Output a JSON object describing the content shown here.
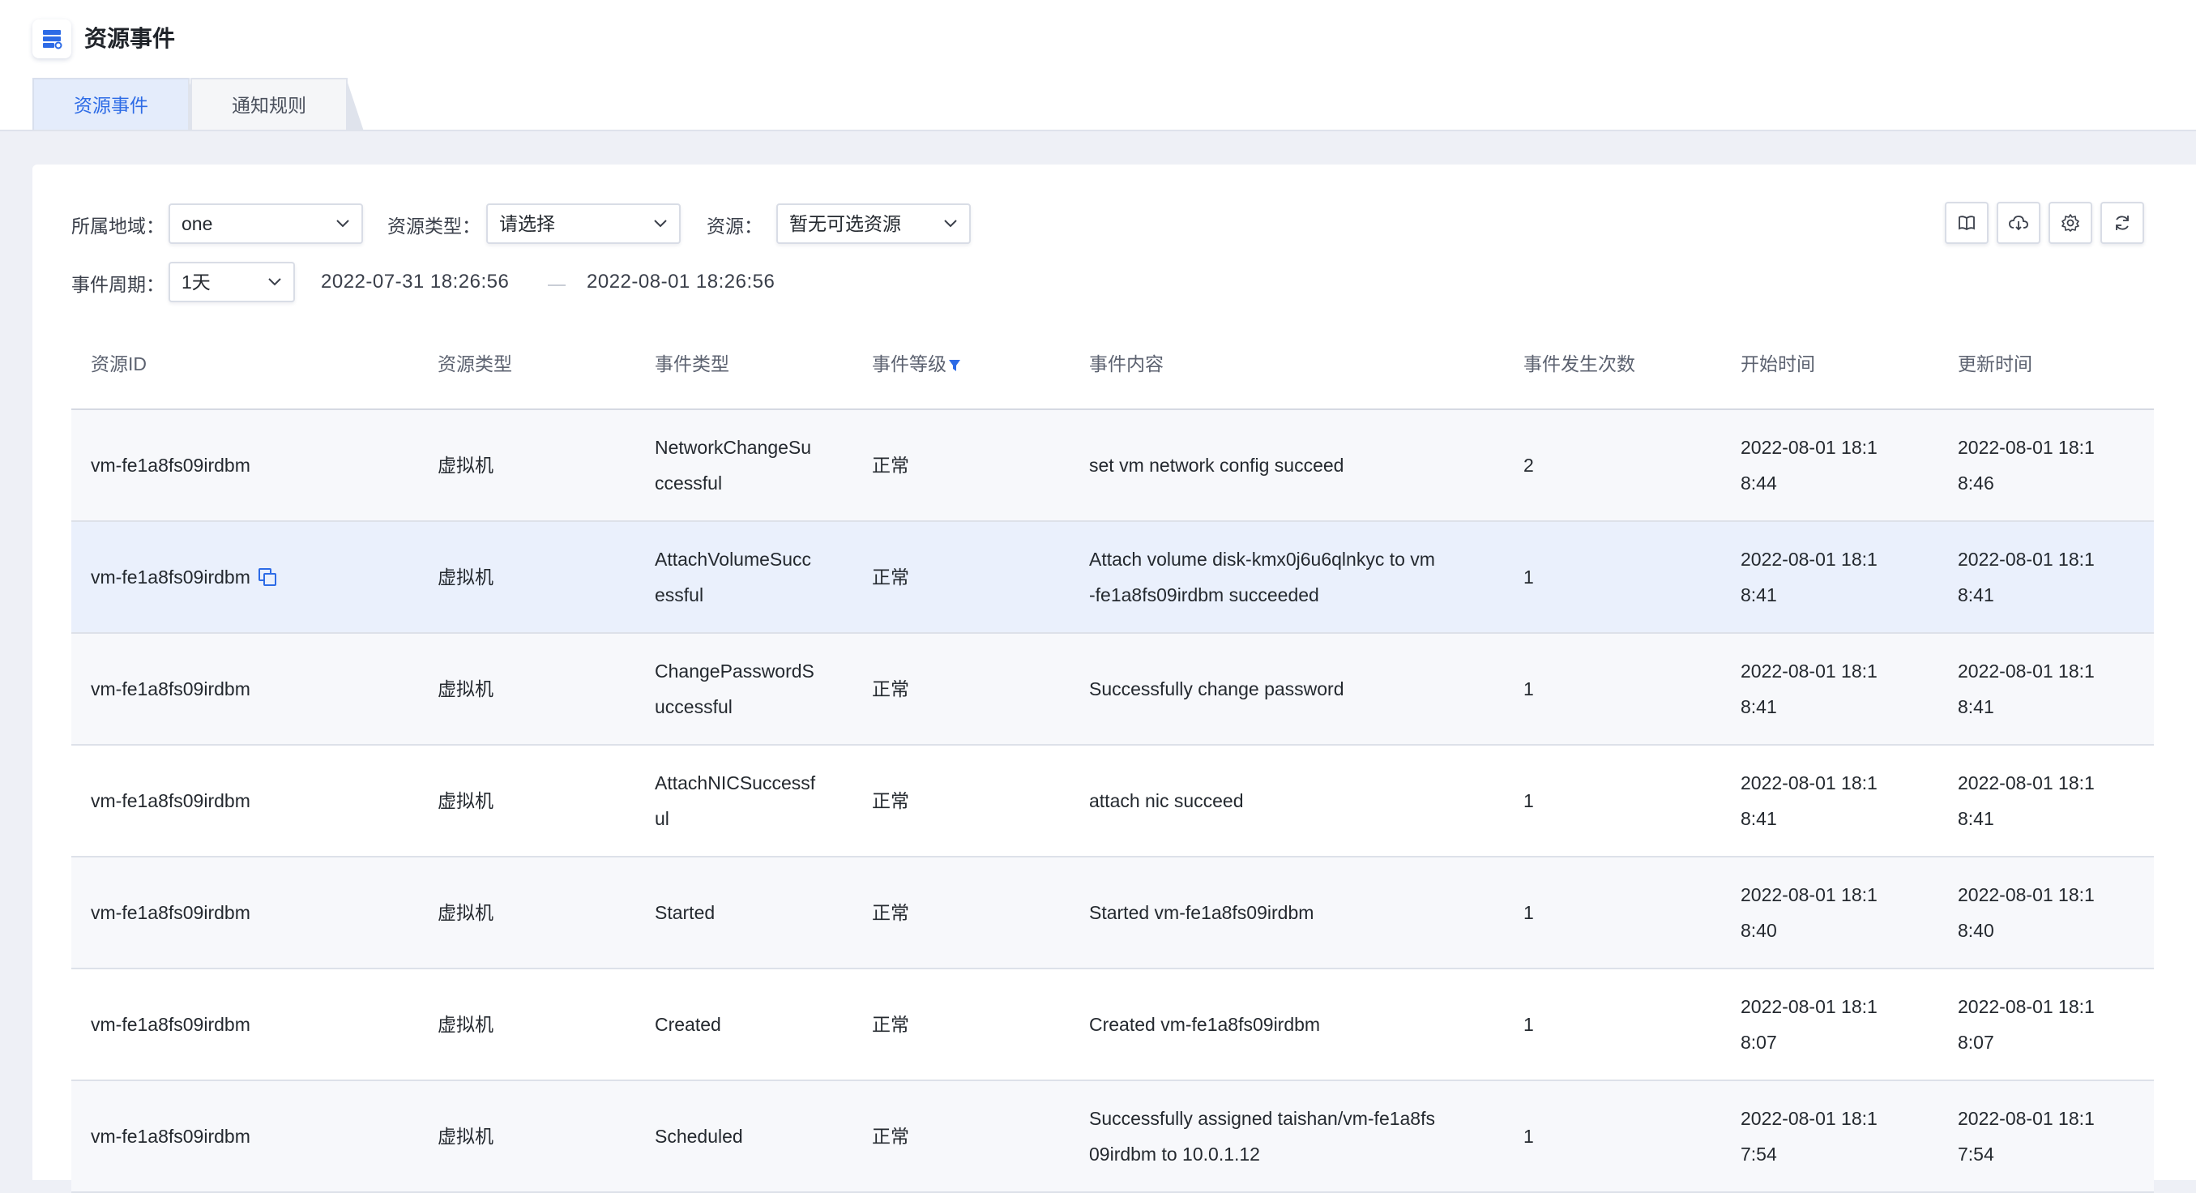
{
  "header": {
    "title": "资源事件",
    "app_icon": "server-list-icon"
  },
  "tabs": [
    {
      "label": "资源事件",
      "active": true
    },
    {
      "label": "通知规则",
      "active": false
    }
  ],
  "filters": {
    "region_label": "所属地域：",
    "region_value": "one",
    "resource_type_label": "资源类型：",
    "resource_type_value": "请选择",
    "resource_label": "资源：",
    "resource_value": "暂无可选资源",
    "period_label": "事件周期：",
    "period_value": "1天",
    "start_time": "2022-07-31 18:26:56",
    "end_time": "2022-08-01 18:26:56"
  },
  "toolbar": {
    "icons": [
      "book-icon",
      "cloud-download-icon",
      "settings-icon",
      "refresh-icon"
    ]
  },
  "table": {
    "columns": [
      "资源ID",
      "资源类型",
      "事件类型",
      "事件等级",
      "事件内容",
      "事件发生次数",
      "开始时间",
      "更新时间"
    ],
    "rows": [
      {
        "id": "vm-fe1a8fs09irdbm",
        "type": "虚拟机",
        "event_type": [
          "NetworkChangeSu",
          "ccessful"
        ],
        "level": "正常",
        "content": [
          "set vm network config succeed"
        ],
        "count": "2",
        "start": [
          "2022-08-01 18:1",
          "8:44"
        ],
        "update": [
          "2022-08-01 18:1",
          "8:46"
        ]
      },
      {
        "id": "vm-fe1a8fs09irdbm",
        "type": "虚拟机",
        "event_type": [
          "AttachVolumeSucc",
          "essful"
        ],
        "level": "正常",
        "content": [
          "Attach volume disk-kmx0j6u6qlnkyc to vm",
          "-fe1a8fs09irdbm succeeded"
        ],
        "count": "1",
        "start": [
          "2022-08-01 18:1",
          "8:41"
        ],
        "update": [
          "2022-08-01 18:1",
          "8:41"
        ]
      },
      {
        "id": "vm-fe1a8fs09irdbm",
        "type": "虚拟机",
        "event_type": [
          "ChangePasswordS",
          "uccessful"
        ],
        "level": "正常",
        "content": [
          "Successfully change password"
        ],
        "count": "1",
        "start": [
          "2022-08-01 18:1",
          "8:41"
        ],
        "update": [
          "2022-08-01 18:1",
          "8:41"
        ]
      },
      {
        "id": "vm-fe1a8fs09irdbm",
        "type": "虚拟机",
        "event_type": [
          "AttachNICSuccessf",
          "ul"
        ],
        "level": "正常",
        "content": [
          "attach nic succeed"
        ],
        "count": "1",
        "start": [
          "2022-08-01 18:1",
          "8:41"
        ],
        "update": [
          "2022-08-01 18:1",
          "8:41"
        ]
      },
      {
        "id": "vm-fe1a8fs09irdbm",
        "type": "虚拟机",
        "event_type": [
          "Started"
        ],
        "level": "正常",
        "content": [
          "Started vm-fe1a8fs09irdbm"
        ],
        "count": "1",
        "start": [
          "2022-08-01 18:1",
          "8:40"
        ],
        "update": [
          "2022-08-01 18:1",
          "8:40"
        ]
      },
      {
        "id": "vm-fe1a8fs09irdbm",
        "type": "虚拟机",
        "event_type": [
          "Created"
        ],
        "level": "正常",
        "content": [
          "Created vm-fe1a8fs09irdbm"
        ],
        "count": "1",
        "start": [
          "2022-08-01 18:1",
          "8:07"
        ],
        "update": [
          "2022-08-01 18:1",
          "8:07"
        ]
      },
      {
        "id": "vm-fe1a8fs09irdbm",
        "type": "虚拟机",
        "event_type": [
          "Scheduled"
        ],
        "level": "正常",
        "content": [
          "Successfully assigned taishan/vm-fe1a8fs",
          "09irdbm to 10.0.1.12"
        ],
        "count": "1",
        "start": [
          "2022-08-01 18:1",
          "7:54"
        ],
        "update": [
          "2022-08-01 18:1",
          "7:54"
        ]
      }
    ]
  },
  "colors": {
    "accent": "#2d6be6",
    "row_highlight": "#eaf0fc",
    "row_bg": "#f7f8fb"
  }
}
